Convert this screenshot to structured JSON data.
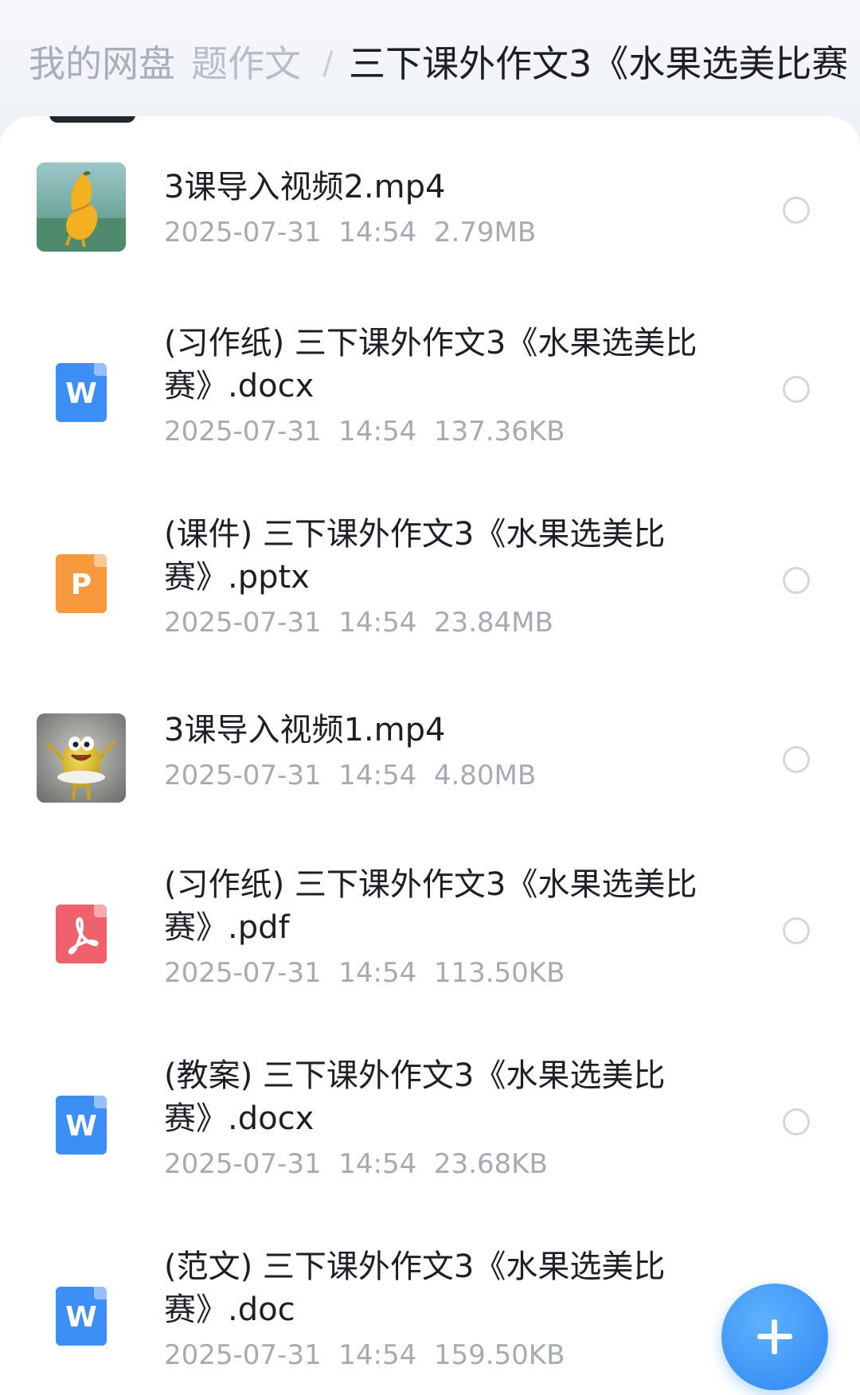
{
  "breadcrumb": {
    "root": "我的网盘",
    "middle": "题作文",
    "separator": "/",
    "current": "三下课外作文3《水果选美比赛"
  },
  "files": [
    {
      "name": "3课导入视频2.mp4",
      "date": "2025-07-31",
      "time": "14:54",
      "size": "2.79MB",
      "type": "video",
      "icon": "video-thumbnail-icon"
    },
    {
      "name": "(习作纸) 三下课外作文3《水果选美比赛》.docx",
      "date": "2025-07-31",
      "time": "14:54",
      "size": "137.36KB",
      "type": "word",
      "icon": "word-doc-icon",
      "icon_letter": "W",
      "color": "#3d8ef5"
    },
    {
      "name": "(课件) 三下课外作文3《水果选美比赛》.pptx",
      "date": "2025-07-31",
      "time": "14:54",
      "size": "23.84MB",
      "type": "ppt",
      "icon": "ppt-doc-icon",
      "icon_letter": "P",
      "color": "#f79a3e"
    },
    {
      "name": "3课导入视频1.mp4",
      "date": "2025-07-31",
      "time": "14:54",
      "size": "4.80MB",
      "type": "video",
      "icon": "video-thumbnail-icon"
    },
    {
      "name": "(习作纸) 三下课外作文3《水果选美比赛》.pdf",
      "date": "2025-07-31",
      "time": "14:54",
      "size": "113.50KB",
      "type": "pdf",
      "icon": "pdf-doc-icon",
      "color": "#f0616e"
    },
    {
      "name": "(教案) 三下课外作文3《水果选美比赛》.docx",
      "date": "2025-07-31",
      "time": "14:54",
      "size": "23.68KB",
      "type": "word",
      "icon": "word-doc-icon",
      "icon_letter": "W",
      "color": "#3d8ef5"
    },
    {
      "name": "(范文) 三下课外作文3《水果选美比赛》.doc",
      "date": "2025-07-31",
      "time": "14:54",
      "size": "159.50KB",
      "type": "word",
      "icon": "word-doc-icon",
      "icon_letter": "W",
      "color": "#3d8ef5"
    }
  ],
  "fab": {
    "icon": "plus-icon",
    "color": "#2e86f2"
  }
}
